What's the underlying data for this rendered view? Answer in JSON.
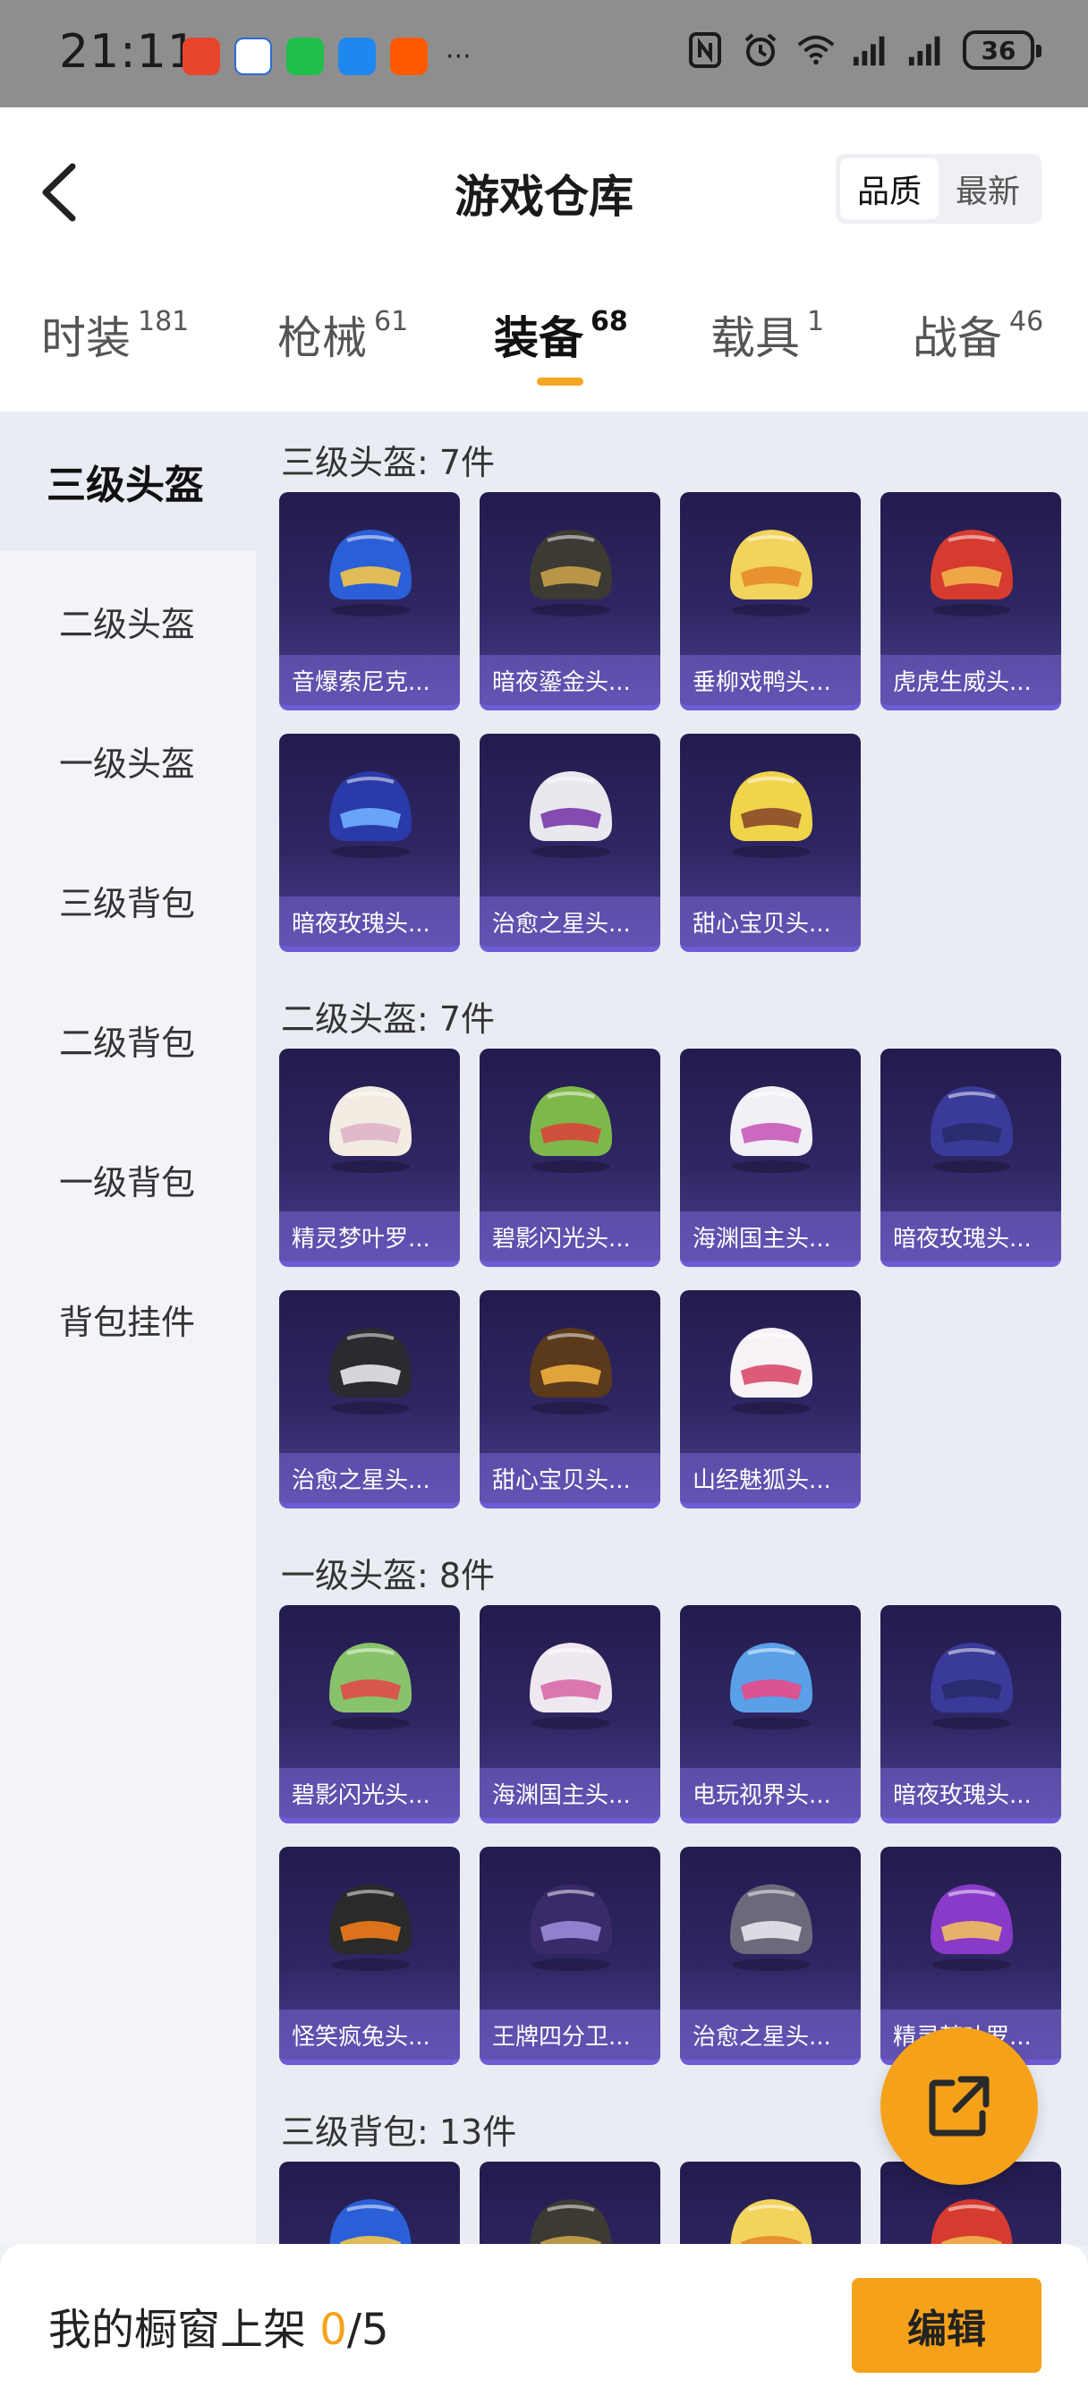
{
  "status_bar": {
    "time": "21:11",
    "more": "···",
    "battery": "36"
  },
  "header": {
    "title": "游戏仓库",
    "sort": [
      "品质",
      "最新"
    ]
  },
  "tabs": [
    {
      "label": "时装",
      "count": "181"
    },
    {
      "label": "枪械",
      "count": "61"
    },
    {
      "label": "装备",
      "count": "68"
    },
    {
      "label": "载具",
      "count": "1"
    },
    {
      "label": "战备",
      "count": "46"
    }
  ],
  "sidebar": [
    "三级头盔",
    "二级头盔",
    "一级头盔",
    "三级背包",
    "二级背包",
    "一级背包",
    "背包挂件"
  ],
  "sections": [
    {
      "title": "三级头盔: 7件",
      "items": [
        "音爆索尼克...",
        "暗夜鎏金头...",
        "垂柳戏鸭头...",
        "虎虎生威头...",
        "暗夜玫瑰头...",
        "治愈之星头...",
        "甜心宝贝头..."
      ]
    },
    {
      "title": "二级头盔: 7件",
      "items": [
        "精灵梦叶罗...",
        "碧影闪光头...",
        "海渊国主头...",
        "暗夜玫瑰头...",
        "治愈之星头...",
        "甜心宝贝头...",
        "山经魅狐头..."
      ]
    },
    {
      "title": "一级头盔: 8件",
      "items": [
        "碧影闪光头...",
        "海渊国主头...",
        "电玩视界头...",
        "暗夜玫瑰头...",
        "怪笑疯兔头...",
        "王牌四分卫...",
        "治愈之星头...",
        "精灵梦叶罗..."
      ]
    },
    {
      "title": "三级背包: 13件",
      "items": []
    }
  ],
  "colors": {
    "accent": "#f5a21a",
    "card_bg": "#2f2764"
  },
  "bottom": {
    "label": "我的橱窗上架 ",
    "count": "0",
    "total": "/5",
    "edit": "编辑"
  }
}
